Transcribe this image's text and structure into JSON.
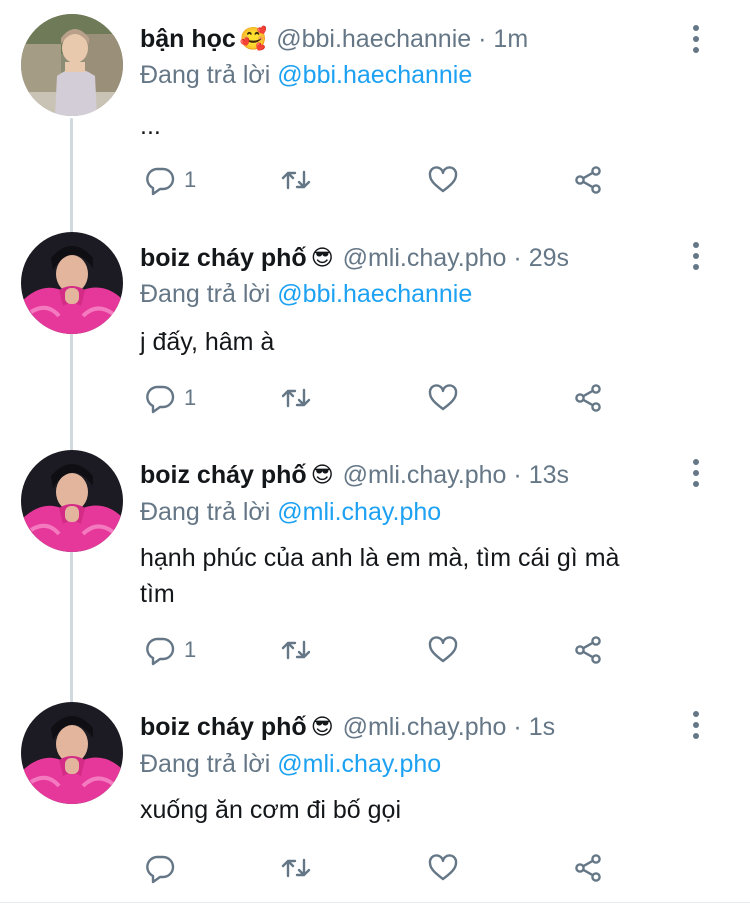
{
  "colors": {
    "accent": "#1da1f2",
    "muted": "#657786",
    "text": "#14171a",
    "thread_line": "#cfd9de"
  },
  "tweets": [
    {
      "display_name": "bận học",
      "emoji": "🥰",
      "handle": "@bbi.haechannie",
      "separator": "·",
      "time": "1m",
      "replying_prefix": "Đang trả lời",
      "replying_to": "@bbi.haechannie",
      "text": "...",
      "reply_count": "1",
      "avatar": "profile-photo-outdoor"
    },
    {
      "display_name": "boiz cháy phố",
      "emoji": "😎",
      "handle": "@mli.chay.pho",
      "separator": "·",
      "time": "29s",
      "replying_prefix": "Đang trả lời",
      "replying_to": "@bbi.haechannie",
      "text": "j đấy, hâm à",
      "reply_count": "1",
      "avatar": "profile-photo-pink-sweater"
    },
    {
      "display_name": "boiz cháy phố",
      "emoji": "😎",
      "handle": "@mli.chay.pho",
      "separator": "·",
      "time": "13s",
      "replying_prefix": "Đang trả lời",
      "replying_to": "@mli.chay.pho",
      "text": "hạnh phúc của anh là em mà, tìm cái gì mà tìm",
      "reply_count": "1",
      "avatar": "profile-photo-pink-sweater"
    },
    {
      "display_name": "boiz cháy phố",
      "emoji": "😎",
      "handle": "@mli.chay.pho",
      "separator": "·",
      "time": "1s",
      "replying_prefix": "Đang trả lời",
      "replying_to": "@mli.chay.pho",
      "text": "xuống ăn cơm đi bố gọi",
      "reply_count": "",
      "avatar": "profile-photo-pink-sweater"
    }
  ]
}
